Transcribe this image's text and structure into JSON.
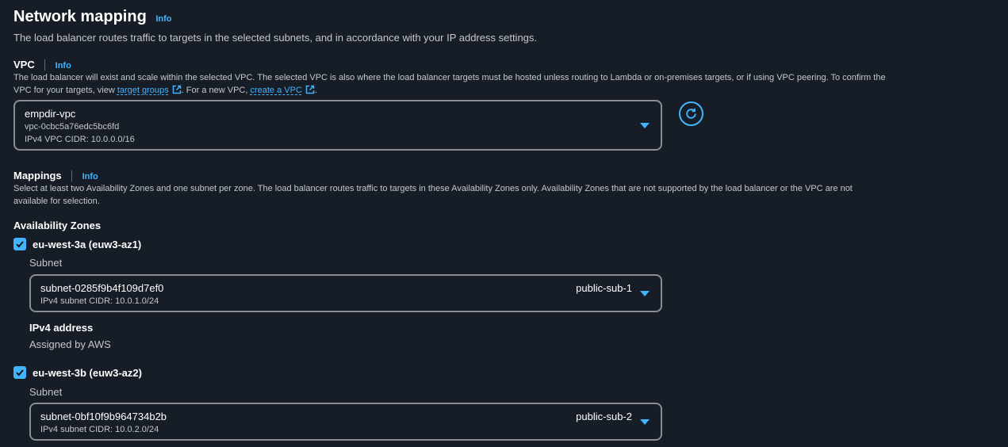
{
  "section": {
    "title": "Network mapping",
    "info": "Info",
    "description": "The load balancer routes traffic to targets in the selected subnets, and in accordance with your IP address settings."
  },
  "vpc": {
    "label": "VPC",
    "info": "Info",
    "desc_line1": "The load balancer will exist and scale within the selected VPC. The selected VPC is also where the load balancer targets must be hosted unless routing to Lambda or on-premises targets, or if using VPC peering. To confirm the",
    "desc_pre": "VPC for your targets, view ",
    "link_target_groups": "target groups",
    "desc_mid": ". For a new VPC, ",
    "link_create_vpc": "create a VPC",
    "desc_end": ".",
    "selected_name": "empdir-vpc",
    "selected_id": "vpc-0cbc5a76edc5bc6fd",
    "selected_cidr": "IPv4 VPC CIDR: 10.0.0.0/16"
  },
  "mappings": {
    "label": "Mappings",
    "info": "Info",
    "desc_line1": "Select at least two Availability Zones and one subnet per zone. The load balancer routes traffic to targets in these Availability Zones only. Availability Zones that are not supported by the load balancer or the VPC are not",
    "desc_line2": "available for selection.",
    "az_heading": "Availability Zones",
    "zones": [
      {
        "name": "eu-west-3a (euw3-az1)",
        "subnet_label": "Subnet",
        "subnet_id": "subnet-0285f9b4f109d7ef0",
        "subnet_cidr": "IPv4 subnet CIDR: 10.0.1.0/24",
        "subnet_name": "public-sub-1",
        "ipv4_label": "IPv4 address",
        "ipv4_value": "Assigned by AWS"
      },
      {
        "name": "eu-west-3b (euw3-az2)",
        "subnet_label": "Subnet",
        "subnet_id": "subnet-0bf10f9b964734b2b",
        "subnet_cidr": "IPv4 subnet CIDR: 10.0.2.0/24",
        "subnet_name": "public-sub-2"
      }
    ]
  },
  "colors": {
    "background": "#161d26",
    "accent": "#42b4ff",
    "border": "#8c8c94"
  },
  "icons": [
    "external-link-icon",
    "refresh-icon",
    "caret-down-icon",
    "check-icon"
  ]
}
